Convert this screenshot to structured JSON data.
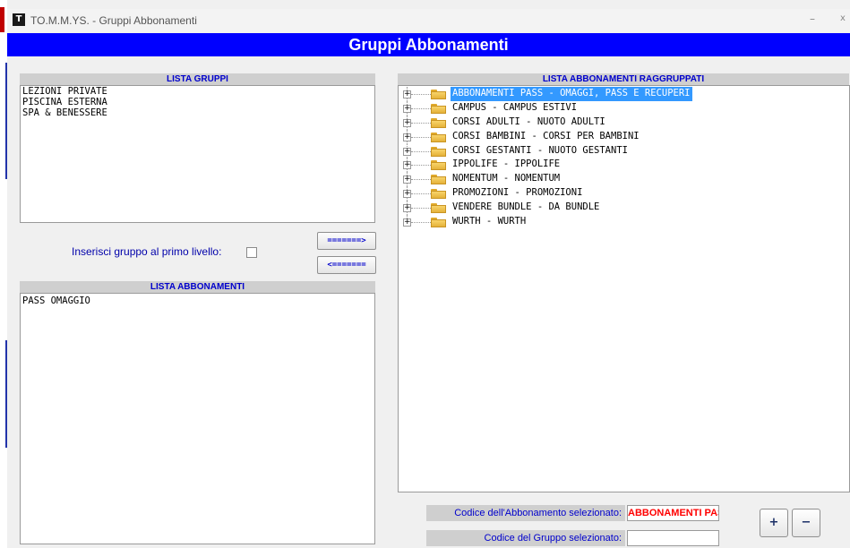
{
  "window": {
    "title": "TO.M.M.YS. - Gruppi Abbonamenti",
    "icon_letter": "T",
    "minimize_icon": "minimize-icon",
    "close_icon": "close-icon",
    "minimize_glyph": "–",
    "close_glyph": "x"
  },
  "header": {
    "title": "Gruppi Abbonamenti"
  },
  "lista_gruppi": {
    "header": "LISTA GRUPPI",
    "items": [
      "LEZIONI PRIVATE",
      "PISCINA ESTERNA",
      "SPA & BENESSERE"
    ]
  },
  "inserisci": {
    "label": "Inserisci gruppo al primo livello:",
    "checked": false
  },
  "move_buttons": {
    "right": "=======>",
    "left": "<======="
  },
  "lista_abbonamenti": {
    "header": "LISTA ABBONAMENTI",
    "items": [
      "PASS OMAGGIO"
    ]
  },
  "lista_raggruppati": {
    "header": "LISTA ABBONAMENTI RAGGRUPPATI",
    "selected_index": 0,
    "nodes": [
      "ABBONAMENTI PASS - OMAGGI, PASS E RECUPERI",
      "CAMPUS - CAMPUS ESTIVI",
      "CORSI ADULTI - NUOTO ADULTI",
      "CORSI BAMBINI - CORSI PER BAMBINI",
      "CORSI GESTANTI - NUOTO GESTANTI",
      "IPPOLIFE - IPPOLIFE",
      "NOMENTUM - NOMENTUM",
      "PROMOZIONI - PROMOZIONI",
      "VENDERE BUNDLE - DA BUNDLE",
      "WURTH - WURTH"
    ]
  },
  "fields": {
    "codice_abbonamento": {
      "label": "Codice dell'Abbonamento selezionato:",
      "value": "ABBONAMENTI PASS"
    },
    "codice_gruppo": {
      "label": "Codice del Gruppo selezionato:",
      "value": ""
    }
  },
  "tools": {
    "add_icon": "add-icon",
    "remove_icon": "remove-icon",
    "add_glyph": "+",
    "remove_glyph": "−"
  },
  "colors": {
    "header_band": "#0000ff",
    "panel_title": "#0000cc",
    "selection": "#3399ff",
    "value_text": "#ff0000"
  }
}
